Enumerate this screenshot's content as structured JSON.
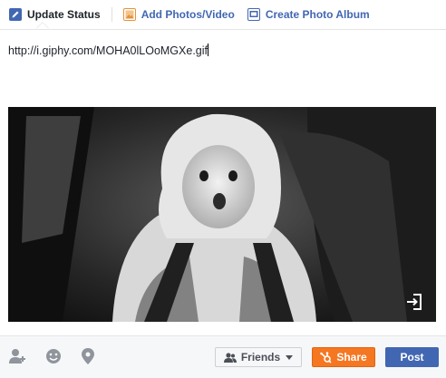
{
  "tabs": [
    {
      "label": "Update Status",
      "icon": "pencil-icon"
    },
    {
      "label": "Add Photos/Video",
      "icon": "photo-icon"
    },
    {
      "label": "Create Photo Album",
      "icon": "album-icon"
    }
  ],
  "status": {
    "text": "http://i.giphy.com/MOHA0lLOoMGXe.gif"
  },
  "preview": {
    "image": "giphy-preview",
    "expand_icon": "expand-icon"
  },
  "footer": {
    "icons": [
      "tag-friends-icon",
      "feeling-icon",
      "location-icon"
    ],
    "audience_label": "Friends",
    "share_label": "Share",
    "post_label": "Post"
  },
  "colors": {
    "link_blue": "#4267b2",
    "share_orange": "#f57722",
    "post_blue": "#4267b2"
  }
}
